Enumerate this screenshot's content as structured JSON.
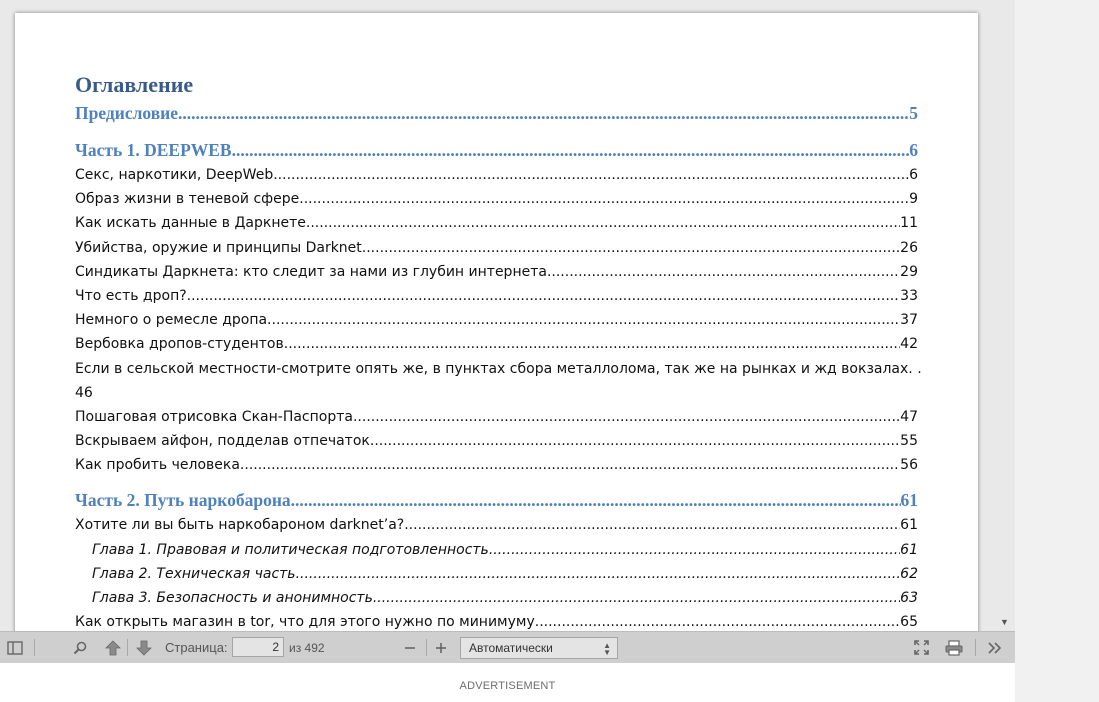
{
  "document": {
    "toc_title": "Оглавление",
    "entries": [
      {
        "text": "Предисловие",
        "page": "5",
        "kind": "part"
      },
      {
        "text": "Часть 1. DEEPWEB",
        "page": "6",
        "kind": "part"
      },
      {
        "text": "Секс, наркотики, DeepWeb",
        "page": "6",
        "kind": "item"
      },
      {
        "text": "Образ жизни в теневой сфере.",
        "page": "9",
        "kind": "item"
      },
      {
        "text": "Как искать данные в Даркнете",
        "page": "11",
        "kind": "item"
      },
      {
        "text": "Убийства, оружие и принципы Darknet",
        "page": "26",
        "kind": "item"
      },
      {
        "text": "Синдикаты Даркнета: кто следит за нами из глубин интернета",
        "page": "29",
        "kind": "item"
      },
      {
        "text": "Что есть дроп?",
        "page": "33",
        "kind": "item"
      },
      {
        "text": "Немного о ремесле дропа.",
        "page": "37",
        "kind": "item"
      },
      {
        "text": "Вербовка дропов-студентов",
        "page": "42",
        "kind": "item"
      },
      {
        "text": "Если в сельской местности-смотрите опять же, в пунктах сбора металлолома, так же на рынках и жд вокзалах. .",
        "page": "46",
        "kind": "wrap"
      },
      {
        "text": "Пошаговая отрисовка Скан-Паспорта.",
        "page": "47",
        "kind": "item"
      },
      {
        "text": "Вскрываем айфон, подделав отпечаток.",
        "page": "55",
        "kind": "item"
      },
      {
        "text": "Как пробить человека",
        "page": "56",
        "kind": "item"
      },
      {
        "text": "Часть 2. Путь наркобарона",
        "page": "61",
        "kind": "part"
      },
      {
        "text": "Хотите ли вы быть наркобароном darknet’a?",
        "page": "61",
        "kind": "item"
      },
      {
        "text": "Глава 1. Правовая и политическая подготовленность.",
        "page": "61",
        "kind": "sub"
      },
      {
        "text": "Глава 2. Техническая часть",
        "page": "62",
        "kind": "sub"
      },
      {
        "text": "Глава 3. Безопасность и анонимность.",
        "page": "63",
        "kind": "sub"
      },
      {
        "text": "Как открыть магазин в tor, что для этого нужно по минимуму",
        "page": "65",
        "kind": "item"
      }
    ]
  },
  "toolbar": {
    "page_label": "Страница:",
    "page_value": "2",
    "page_total": "из 492",
    "zoom_value": "Автоматически",
    "icons": [
      "sidebar-toggle-icon",
      "search-icon",
      "arrow-up-icon",
      "arrow-down-icon",
      "minus-icon",
      "plus-icon",
      "fullscreen-icon",
      "print-icon",
      "double-chevron-right-icon"
    ]
  },
  "footer": {
    "ad_label": "ADVERTISEMENT"
  },
  "colors": {
    "heading": "#3a5b8a",
    "part": "#4f81bd",
    "toolbar_bg": "#cfcfcf"
  }
}
